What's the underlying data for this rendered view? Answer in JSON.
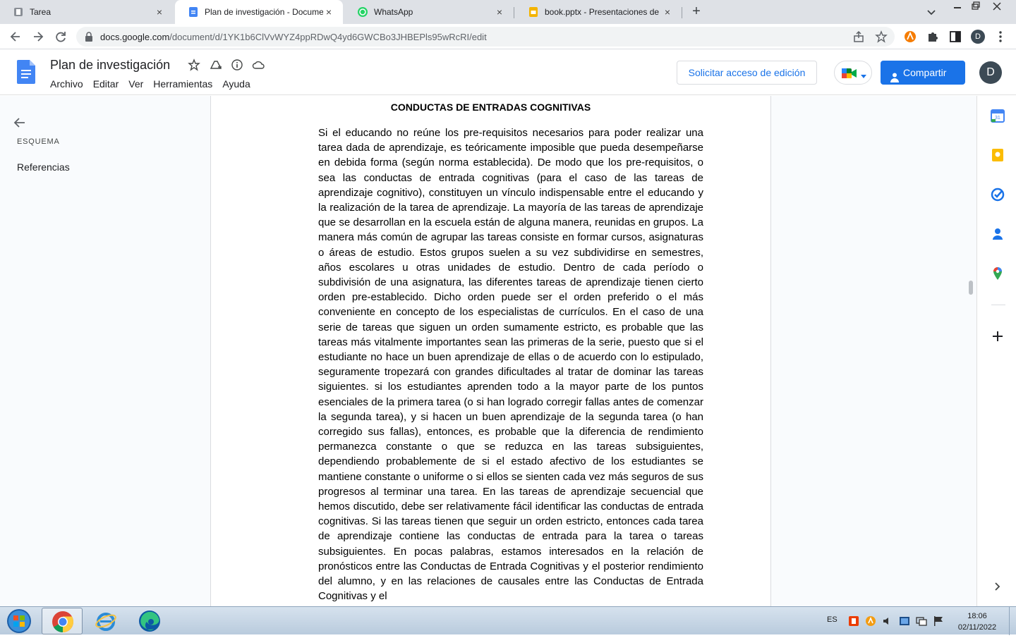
{
  "browser": {
    "tabs": [
      {
        "label": "Tarea",
        "active": false
      },
      {
        "label": "Plan de investigación - Documen",
        "active": true
      },
      {
        "label": "WhatsApp",
        "active": false
      },
      {
        "label": "book.pptx - Presentaciones de Go",
        "active": false
      }
    ],
    "close_glyph": "×",
    "new_tab_glyph": "+",
    "url_host": "docs.google.com",
    "url_path": "/document/d/1YK1b6ClVvWYZ4ppRDwQ4yd6GWCBo3JHBEPls95wRcRI/edit",
    "profile_initial": "D"
  },
  "docs": {
    "title": "Plan de investigación",
    "menu": [
      "Archivo",
      "Editar",
      "Ver",
      "Herramientas",
      "Ayuda"
    ],
    "request_edit_label": "Solicitar acceso de edición",
    "share_label": "Compartir",
    "user_initial": "D",
    "accent_color": "#1a73e8"
  },
  "outline": {
    "heading": "ESQUEMA",
    "items": [
      "Referencias"
    ]
  },
  "document": {
    "heading": "CONDUCTAS DE ENTRADAS COGNITIVAS",
    "body": "Si el educando no reúne los pre-requisitos necesarios para poder realizar una tarea dada de aprendizaje, es teóricamente imposible que pueda desempeñarse en debida forma (según norma establecida). De modo que los pre-requisitos, o sea las conductas de entrada cognitivas (para el caso de las tareas de aprendizaje cognitivo), constituyen un vínculo indispensable entre el educando y la realización de la tarea de aprendizaje. La mayoría de las tareas de aprendizaje que se desarrollan en la escuela están de alguna manera, reunidas en grupos. La manera más común de agrupar las tareas consiste en formar cursos, asignaturas o áreas de estudio. Estos grupos suelen a su vez subdividirse en semestres, años escolares u otras unidades de estudio. Dentro de cada período o subdivisión de una asignatura, las diferentes tareas de aprendizaje tienen cierto orden pre-establecido. Dicho orden puede ser el orden preferido o el más conveniente en concepto de los especialistas de currículos. En el caso de una serie de tareas que siguen un orden sumamente estricto, es probable que las tareas más vitalmente importantes sean las primeras de la serie, puesto que si el estudiante no hace un buen aprendizaje de ellas o de acuerdo con lo estipulado, seguramente tropezará con grandes dificultades al tratar de dominar las tareas siguientes. si los estudiantes aprenden todo a la mayor parte de los puntos esenciales de la primera tarea (o si han logrado corregir fallas antes de comenzar la segunda tarea), y si hacen un buen aprendizaje de la segunda tarea (o han corregido sus fallas), entonces, es probable que la diferencia de rendimiento permanezca constante o que se reduzca en las tareas subsiguientes, dependiendo probablemente de si el estado afectivo de los estudiantes se mantiene constante o uniforme o si ellos se sienten cada vez más seguros de sus progresos al terminar una tarea. En las tareas de aprendizaje secuencial que hemos discutido, debe ser relativamente fácil identificar las conductas de entrada cognitivas. Si las tareas tienen que seguir un orden estricto, entonces cada tarea de aprendizaje contiene las conductas de entrada para la tarea o tareas subsiguientes. En pocas palabras, estamos interesados en la relación de pronósticos entre las Conductas de Entrada Cognitivas y el posterior rendimiento del alumno, y en las relaciones de causales entre las Conductas de Entrada Cognitivas y el"
  },
  "taskbar": {
    "language": "ES",
    "time": "18:06",
    "date": "02/11/2022"
  }
}
